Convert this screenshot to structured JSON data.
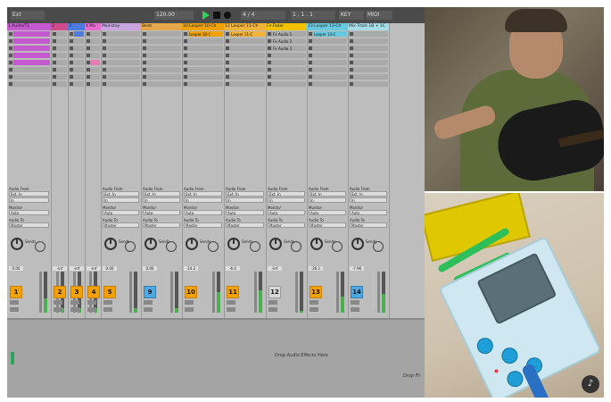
{
  "toolbar": {
    "left_label": "Ext",
    "tempo": "120.00",
    "sig": "4 / 4",
    "pos": "1 . 1 . 1",
    "key": "KEY",
    "midi": "MIDI"
  },
  "tracks": [
    {
      "name": "1 Audio/T1",
      "color": "#c55ad0",
      "clips": [
        "",
        "",
        "",
        "",
        "",
        "",
        "",
        ""
      ],
      "clip_colors": [
        "#c55ad0",
        "#c55ad0",
        "#c55ad0",
        "#c55ad0",
        "#c55ad0",
        "",
        "",
        ""
      ],
      "num": "1",
      "num_style": "orange",
      "vol": "0.00",
      "meter": 0.35
    },
    {
      "name": "2",
      "color": "#d14a8b",
      "clips": [
        "",
        "",
        "",
        "",
        "",
        "",
        "",
        ""
      ],
      "clip_colors": [
        "",
        "",
        "",
        "",
        "",
        "",
        "",
        ""
      ],
      "num": "2",
      "num_style": "orange",
      "vol": "-inf",
      "meter": 0.1
    },
    {
      "name": "3",
      "color": "#4e7be0",
      "clips": [
        "",
        "",
        "",
        "",
        "",
        "",
        "",
        ""
      ],
      "clip_colors": [
        "#4e7be0",
        "",
        "",
        "",
        "",
        "",
        "",
        ""
      ],
      "num": "3",
      "num_style": "orange",
      "vol": "-inf",
      "meter": 0.1
    },
    {
      "name": "4 Ma",
      "color": "#e66ad0",
      "clips": [
        "",
        "",
        "",
        "",
        "",
        "",
        "",
        ""
      ],
      "clip_colors": [
        "",
        "",
        "",
        "",
        "#ea7ab5",
        "",
        "",
        ""
      ],
      "num": "4",
      "num_style": "orange",
      "vol": "-inf",
      "meter": 0.1
    },
    {
      "name": "Mainstay",
      "color": "#c9a6e0",
      "clips": [
        "",
        "",
        "",
        "",
        "",
        "",
        "",
        ""
      ],
      "clip_colors": [
        "",
        "",
        "",
        "",
        "",
        "",
        "",
        ""
      ],
      "num": "5",
      "num_style": "orange",
      "vol": "0.00",
      "meter": 0.1
    },
    {
      "name": "Beds",
      "color": "#e6a64a",
      "clips": [
        "",
        "",
        "",
        "",
        "",
        "",
        "",
        ""
      ],
      "clip_colors": [
        "",
        "",
        "",
        "",
        "",
        "",
        "",
        ""
      ],
      "num": "9",
      "num_style": "blue",
      "vol": "0.00",
      "meter": 0.1
    },
    {
      "name": "10 Looper 10-Ch",
      "color": "#f2a200",
      "clips": [
        "Looper 10-C",
        "",
        "",
        "",
        "",
        "",
        "",
        ""
      ],
      "clip_colors": [
        "#f2a200",
        "",
        "",
        "",
        "",
        "",
        "",
        ""
      ],
      "num": "10",
      "num_style": "orange",
      "vol": "-14.2",
      "meter": 0.5
    },
    {
      "name": "11 Looper 11-Ch",
      "color": "#f0b23a",
      "clips": [
        "Looper 11-C",
        "",
        "",
        "",
        "",
        "",
        "",
        ""
      ],
      "clip_colors": [
        "#f0b23a",
        "",
        "",
        "",
        "",
        "",
        "",
        ""
      ],
      "num": "11",
      "num_style": "orange",
      "vol": "-6.0",
      "meter": 0.55
    },
    {
      "name": "Fx Fader",
      "color": "#f2c200",
      "clips": [
        "Fx Audio 1",
        "Fx Audio 2",
        "Fx Audio 3",
        "",
        "",
        "",
        "",
        ""
      ],
      "clip_colors": [
        "",
        "",
        "",
        "",
        "",
        "",
        "",
        ""
      ],
      "num": "12",
      "num_style": "grey",
      "vol": "-inf",
      "meter": 0.05
    },
    {
      "name": "13 Looper 13-Ch",
      "color": "#67c9e0",
      "clips": [
        "Looper 13-C",
        "",
        "",
        "",
        "",
        "",
        "",
        ""
      ],
      "clip_colors": [
        "#67c9e0",
        "",
        "",
        "",
        "",
        "",
        "",
        ""
      ],
      "num": "13",
      "num_style": "orange",
      "vol": "-26.1",
      "meter": 0.4
    },
    {
      "name": "Mix Track 1B + 1C",
      "color": "#a4dde8",
      "clips": [
        "",
        "",
        "",
        "",
        "",
        "",
        "",
        ""
      ],
      "clip_colors": [
        "",
        "",
        "",
        "",
        "",
        "",
        "",
        ""
      ],
      "num": "14",
      "num_style": "blue",
      "vol": "-7.96",
      "meter": 0.45
    }
  ],
  "io": {
    "audio_from": "Audio From",
    "ext_in": "Ext. In",
    "monitor": "Monitor",
    "in": "In",
    "auto": "Auto",
    "off": "Off",
    "audio_to": "Audio To",
    "master": "Master",
    "sends": "Sends"
  },
  "drop": {
    "text": "Drop Audio Effects Here",
    "right": "Drop Fil"
  },
  "video": {
    "mute_icon": "♪"
  }
}
